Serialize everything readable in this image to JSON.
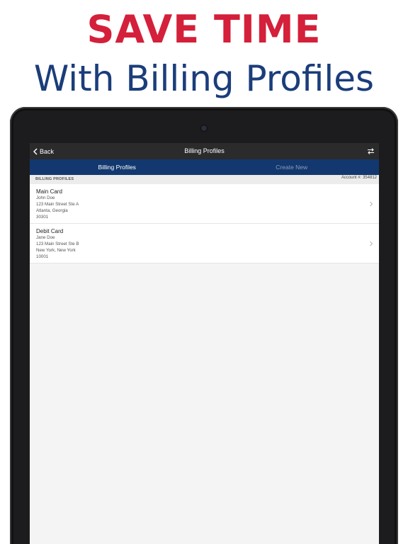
{
  "promo": {
    "headline": "SAVE TIME",
    "subhead": "With Billing Profiles"
  },
  "navbar": {
    "back_label": "Back",
    "title": "Billing Profiles"
  },
  "tabs": [
    {
      "label": "Billing Profiles",
      "active": true
    },
    {
      "label": "Create New",
      "active": false
    }
  ],
  "section": {
    "title": "BILLING PROFILES",
    "account": "Account #: 354812"
  },
  "profiles": [
    {
      "name": "Main Card",
      "holder": "John Doe",
      "street": "123 Main Street Ste A",
      "city": "Atlanta, Georgia",
      "zip": "30301"
    },
    {
      "name": "Debit Card",
      "holder": "Jane Doe",
      "street": "123 Main Street Ste B",
      "city": "New York, New York",
      "zip": "10001"
    }
  ],
  "colors": {
    "headline": "#d4203a",
    "subhead": "#1b3d7a",
    "navbar": "#2b2b2b",
    "tabbar": "#12386f"
  },
  "icons": {
    "back": "chevron-left-icon",
    "swap": "swap-arrows-icon",
    "row": "chevron-right-icon"
  }
}
